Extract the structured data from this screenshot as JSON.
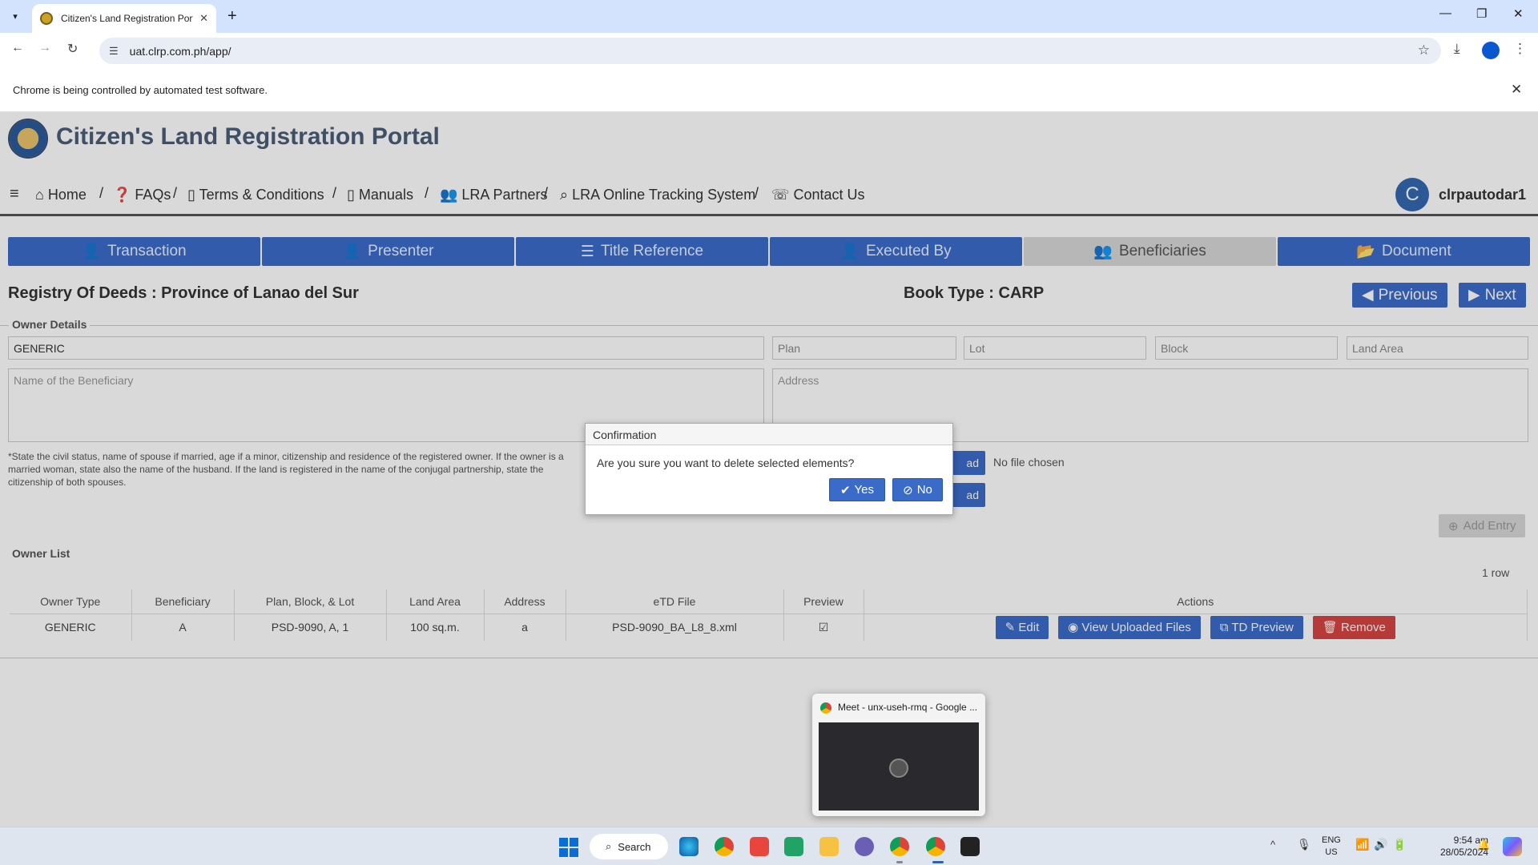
{
  "browser": {
    "tab_title": "Citizen's Land Registration Portal",
    "new_tab": "+",
    "url": "uat.clrp.com.ph/app/",
    "infobar_message": "Chrome is being controlled by automated test software."
  },
  "site": {
    "title": "Citizen's Land Registration Portal",
    "nav": [
      "Home",
      "FAQs",
      "Terms & Conditions",
      "Manuals",
      "LRA Partners",
      "LRA Online Tracking System",
      "Contact Us"
    ],
    "user_initial": "C",
    "username": "clrpautodar1"
  },
  "wizard_tabs": [
    {
      "label": "Transaction",
      "icon": "user-icon"
    },
    {
      "label": "Presenter",
      "icon": "user-icon"
    },
    {
      "label": "Title Reference",
      "icon": "list-icon"
    },
    {
      "label": "Executed By",
      "icon": "user-icon"
    },
    {
      "label": "Beneficiaries",
      "icon": "users-icon",
      "active": true
    },
    {
      "label": "Document",
      "icon": "folder-icon"
    }
  ],
  "header": {
    "registry_label": "Registry Of Deeds :",
    "registry_value": "Province of Lanao del Sur",
    "book_label": "Book Type :",
    "book_value": "CARP",
    "previous": "Previous",
    "next": "Next"
  },
  "owner_details": {
    "legend": "Owner Details",
    "owner_type_value": "GENERIC",
    "plan_placeholder": "Plan",
    "lot_placeholder": "Lot",
    "block_placeholder": "Block",
    "land_area_placeholder": "Land Area",
    "beneficiary_placeholder": "Name of the Beneficiary",
    "address_placeholder": "Address",
    "note": "*State the civil status, name of spouse if married, age if a minor, citizenship and residence of the registered owner. If the owner is a married woman, state also the name of the husband. If the land is registered in the name of the conjugal partnership, state the citizenship of both spouses.",
    "upload_label_1": "ad",
    "upload_label_2": "ad",
    "no_file": "No file chosen",
    "add_entry": "Add Entry"
  },
  "owner_list": {
    "legend": "Owner List",
    "row_count": "1 row",
    "columns": [
      "Owner Type",
      "Beneficiary",
      "Plan, Block, & Lot",
      "Land Area",
      "Address",
      "eTD File",
      "Preview",
      "Actions"
    ],
    "rows": [
      {
        "owner_type": "GENERIC",
        "beneficiary": "A",
        "pbl": "PSD-9090, A, 1",
        "land_area": "100 sq.m.",
        "address": "a",
        "etd_file": "PSD-9090_BA_L8_8.xml",
        "preview": "☑"
      }
    ],
    "actions": {
      "edit": "Edit",
      "view": "View Uploaded Files",
      "td": "TD Preview",
      "remove": "Remove"
    }
  },
  "dialog": {
    "title": "Confirmation",
    "message": "Are you sure you want to delete selected elements?",
    "yes": "Yes",
    "no": "No"
  },
  "thumbnail": {
    "title": "Meet - unx-useh-rmq - Google ..."
  },
  "taskbar": {
    "search": "Search",
    "lang_1": "ENG",
    "lang_2": "US",
    "time": "9:54 am",
    "date": "28/05/2024"
  }
}
